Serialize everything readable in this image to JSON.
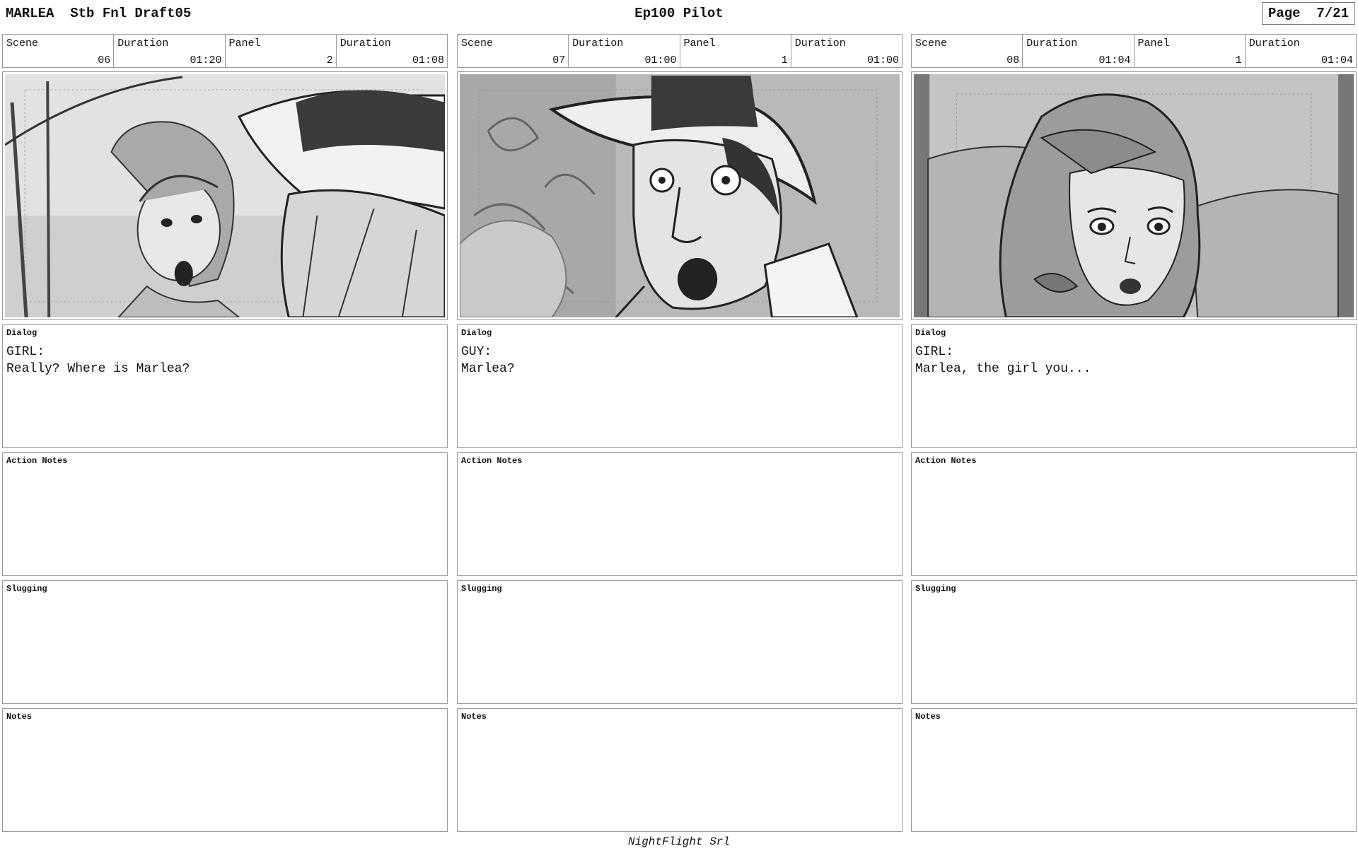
{
  "header": {
    "project": "MARLEA  Stb Fnl Draft05",
    "episode": "Ep100 Pilot",
    "page": "Page  7/21"
  },
  "labels": {
    "scene": "Scene",
    "duration": "Duration",
    "panel": "Panel",
    "dialog": "Dialog",
    "action_notes": "Action Notes",
    "slugging": "Slugging",
    "notes": "Notes"
  },
  "panels": [
    {
      "scene": "06",
      "scene_duration": "01:20",
      "panel": "2",
      "panel_duration": "01:08",
      "dialog_speaker": "GIRL:",
      "dialog_line": "Really? Where is Marlea?",
      "action_notes": "",
      "slugging": "",
      "notes": ""
    },
    {
      "scene": "07",
      "scene_duration": "01:00",
      "panel": "1",
      "panel_duration": "01:00",
      "dialog_speaker": "GUY:",
      "dialog_line": "Marlea?",
      "action_notes": "",
      "slugging": "",
      "notes": ""
    },
    {
      "scene": "08",
      "scene_duration": "01:04",
      "panel": "1",
      "panel_duration": "01:04",
      "dialog_speaker": "GIRL:",
      "dialog_line": "Marlea, the girl you...",
      "action_notes": "",
      "slugging": "",
      "notes": ""
    }
  ],
  "footer": "NightFlight Srl"
}
